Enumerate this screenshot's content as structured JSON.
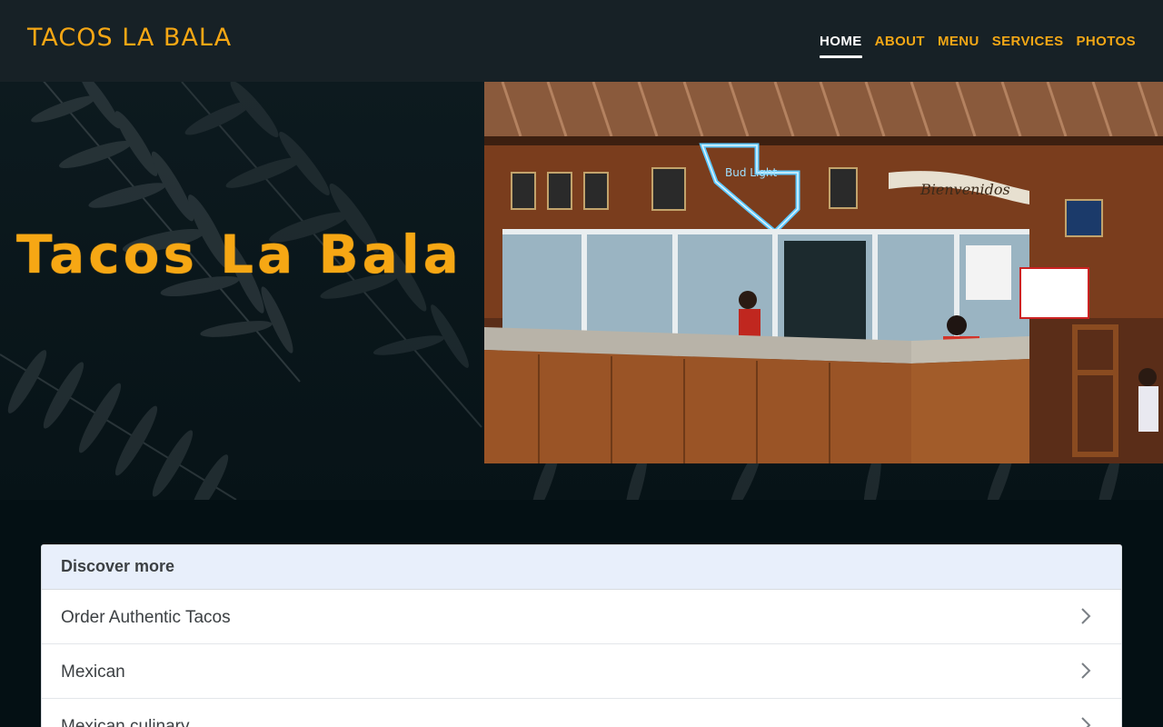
{
  "header": {
    "brand": "TACOS LA BALA",
    "nav": [
      {
        "label": "HOME",
        "active": true
      },
      {
        "label": "ABOUT",
        "active": false
      },
      {
        "label": "MENU",
        "active": false
      },
      {
        "label": "SERVICES",
        "active": false
      },
      {
        "label": "PHOTOS",
        "active": false
      }
    ]
  },
  "hero": {
    "title": "Tacos La Bala",
    "photo": {
      "neon_sign_text": "Bud Light",
      "banner_text": "Bienvenidos"
    }
  },
  "discover": {
    "heading": "Discover more",
    "items": [
      {
        "label": "Order Authentic Tacos",
        "icon": "chevron-right-icon"
      },
      {
        "label": "Mexican",
        "icon": "chevron-right-icon"
      },
      {
        "label": "Mexican culinary",
        "icon": "chevron-right-icon"
      }
    ]
  },
  "colors": {
    "accent": "#f6a714",
    "header_bg": "#172126",
    "page_bg": "#041014",
    "card_head_bg": "#e8effb"
  }
}
